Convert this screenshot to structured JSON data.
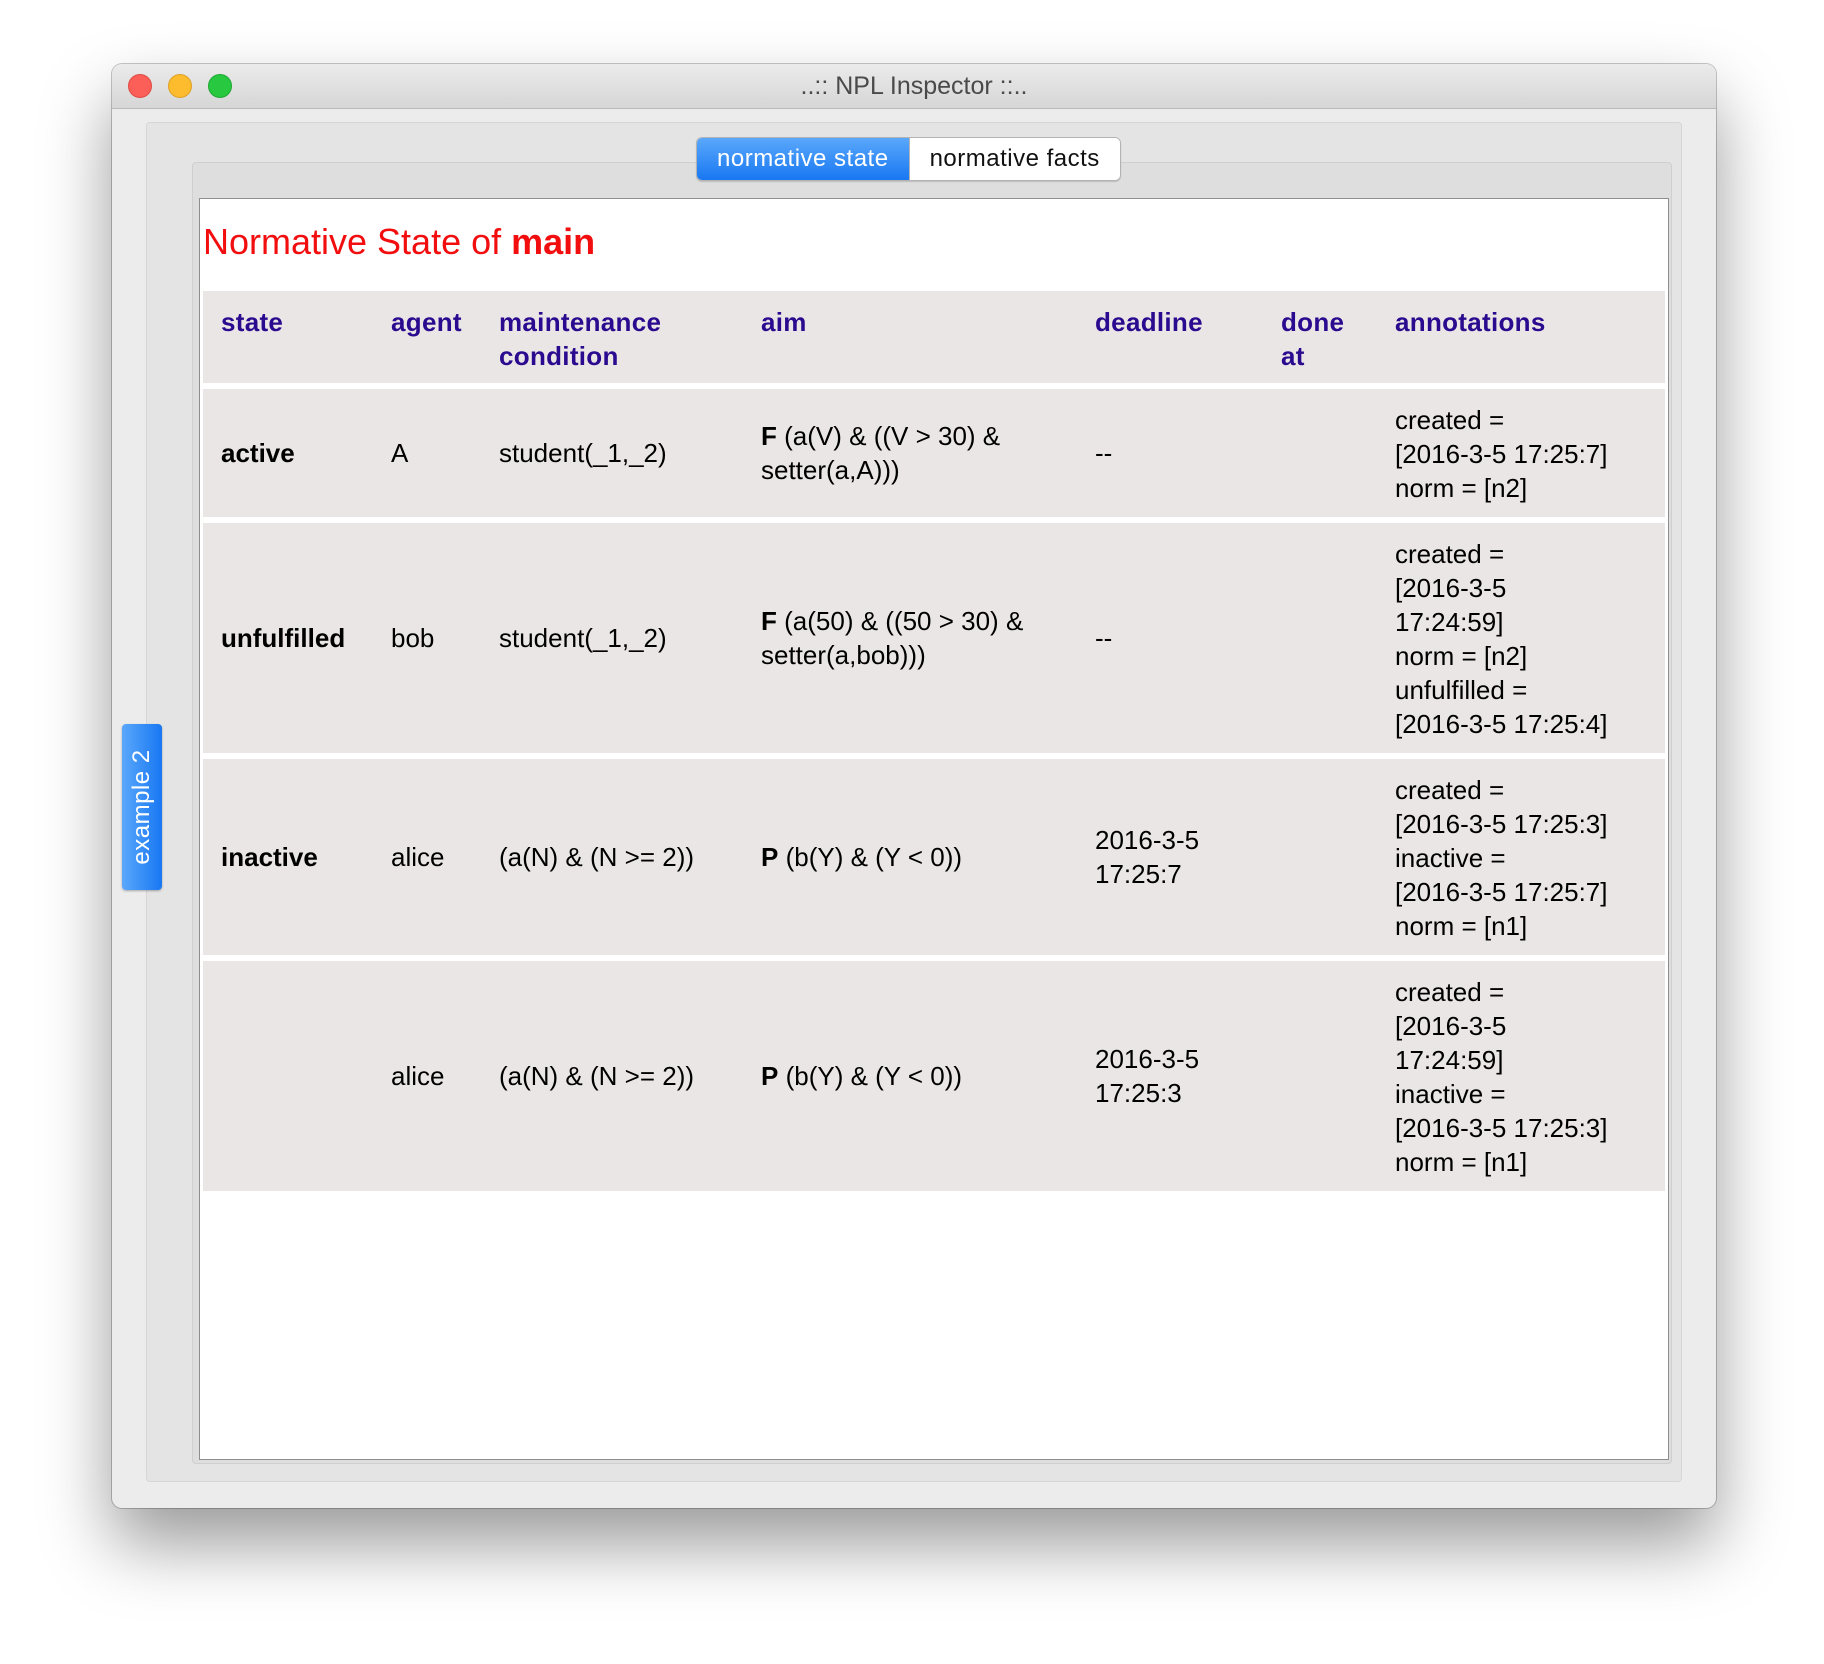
{
  "window": {
    "title": "..:: NPL Inspector ::.."
  },
  "tabs": [
    {
      "label": "normative state",
      "active": true
    },
    {
      "label": "normative facts",
      "active": false
    }
  ],
  "side_tab": {
    "label": "example 2"
  },
  "heading": {
    "prefix": "Normative State of",
    "name": "main"
  },
  "table": {
    "headers": {
      "state": "state",
      "agent": "agent",
      "maintenance_1": "maintenance",
      "maintenance_2": "condition",
      "aim": "aim",
      "deadline": "deadline",
      "done_1": "done",
      "done_2": "at",
      "annotations": "annotations"
    },
    "rows": [
      {
        "state": "active",
        "agent": "A",
        "maintenance": "student(_1,_2)",
        "aim_op": "F",
        "aim_lines": [
          "(a(V) & ((V > 30) &",
          "setter(a,A)))"
        ],
        "deadline": [
          "--"
        ],
        "done": "",
        "annotations": [
          "created =",
          "[2016-3-5 17:25:7]",
          "norm = [n2]"
        ]
      },
      {
        "state": "unfulfilled",
        "agent": "bob",
        "maintenance": "student(_1,_2)",
        "aim_op": "F",
        "aim_lines": [
          "(a(50) & ((50 > 30) &",
          "setter(a,bob)))"
        ],
        "deadline": [
          "--"
        ],
        "done": "",
        "annotations": [
          "created =",
          "[2016-3-5",
          "17:24:59]",
          "norm = [n2]",
          "unfulfilled =",
          "[2016-3-5 17:25:4]"
        ]
      },
      {
        "state": "inactive",
        "agent": "alice",
        "maintenance": "(a(N) & (N >= 2))",
        "aim_op": "P",
        "aim_lines": [
          "(b(Y) & (Y < 0))"
        ],
        "deadline": [
          "2016-3-5",
          "17:25:7"
        ],
        "done": "",
        "annotations": [
          "created =",
          "[2016-3-5 17:25:3]",
          "inactive =",
          "[2016-3-5 17:25:7]",
          "norm = [n1]"
        ]
      },
      {
        "state": "",
        "agent": "alice",
        "maintenance": "(a(N) & (N >= 2))",
        "aim_op": "P",
        "aim_lines": [
          "(b(Y) & (Y < 0))"
        ],
        "deadline": [
          "2016-3-5",
          "17:25:3"
        ],
        "done": "",
        "annotations": [
          "created =",
          "[2016-3-5",
          "17:24:59]",
          "inactive =",
          "[2016-3-5 17:25:3]",
          "norm = [n1]"
        ]
      }
    ]
  }
}
